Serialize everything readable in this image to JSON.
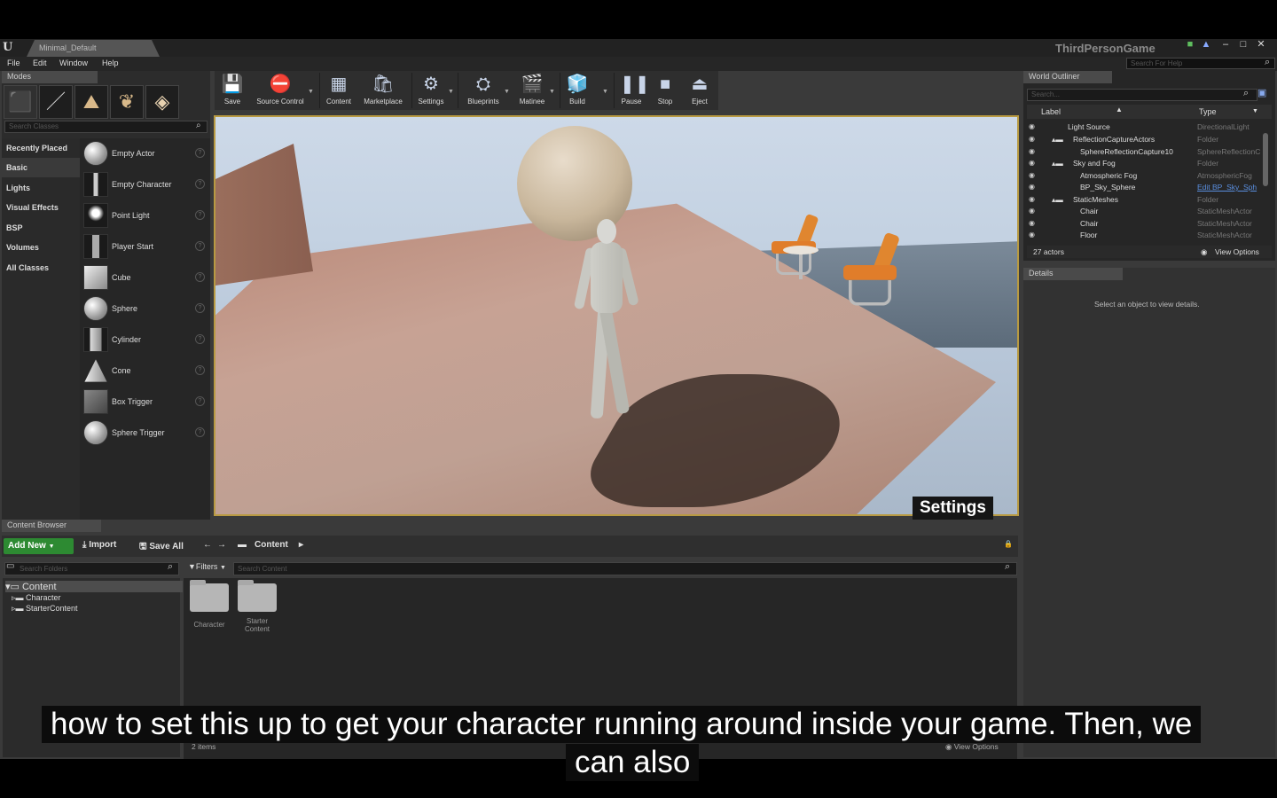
{
  "window": {
    "level_tab": "Minimal_Default",
    "game_title": "ThirdPersonGame",
    "search_help_placeholder": "Search For Help"
  },
  "menu": [
    "File",
    "Edit",
    "Window",
    "Help"
  ],
  "modes": {
    "tab": "Modes",
    "search_placeholder": "Search Classes",
    "categories": [
      "Recently Placed",
      "Basic",
      "Lights",
      "Visual Effects",
      "BSP",
      "Volumes",
      "All Classes"
    ],
    "active_category": "Basic",
    "items": [
      "Empty Actor",
      "Empty Character",
      "Point Light",
      "Player Start",
      "Cube",
      "Sphere",
      "Cylinder",
      "Cone",
      "Box Trigger",
      "Sphere Trigger"
    ]
  },
  "toolbar": {
    "save": "Save",
    "source_control": "Source Control",
    "content": "Content",
    "marketplace": "Marketplace",
    "settings": "Settings",
    "blueprints": "Blueprints",
    "matinee": "Matinee",
    "build": "Build",
    "pause": "Pause",
    "stop": "Stop",
    "eject": "Eject"
  },
  "viewport": {
    "tooltip": "Settings"
  },
  "outliner": {
    "tab": "World Outliner",
    "search_placeholder": "Search...",
    "col_label": "Label",
    "col_type": "Type",
    "rows": [
      {
        "name": "Light Source",
        "type": "DirectionalLight"
      },
      {
        "name": "ReflectionCaptureActors",
        "type": "Folder"
      },
      {
        "name": "SphereReflectionCapture10",
        "type": "SphereReflectionC"
      },
      {
        "name": "Sky and Fog",
        "type": "Folder"
      },
      {
        "name": "Atmospheric Fog",
        "type": "AtmosphericFog"
      },
      {
        "name": "BP_Sky_Sphere",
        "type": "Edit BP_Sky_Sph"
      },
      {
        "name": "StaticMeshes",
        "type": "Folder"
      },
      {
        "name": "Chair",
        "type": "StaticMeshActor"
      },
      {
        "name": "Chair",
        "type": "StaticMeshActor"
      },
      {
        "name": "Floor",
        "type": "StaticMeshActor"
      }
    ],
    "actor_count": "27 actors",
    "view_options": "View Options"
  },
  "details": {
    "tab": "Details",
    "message": "Select an object to view details."
  },
  "content_browser": {
    "tab": "Content Browser",
    "add_new": "Add New",
    "import": "Import",
    "save_all": "Save All",
    "path": "Content",
    "folder_search_placeholder": "Search Folders",
    "filters": "Filters",
    "content_search_placeholder": "Search Content",
    "tree": [
      "Content",
      "Character",
      "StarterContent"
    ],
    "assets": [
      {
        "label": "Character"
      },
      {
        "label": "Starter Content"
      }
    ],
    "items_count": "2 items",
    "view_options": "View Options"
  },
  "subtitles": {
    "line1": "how to set this up to get your character running around inside your game. Then, we",
    "line2": "can also"
  }
}
